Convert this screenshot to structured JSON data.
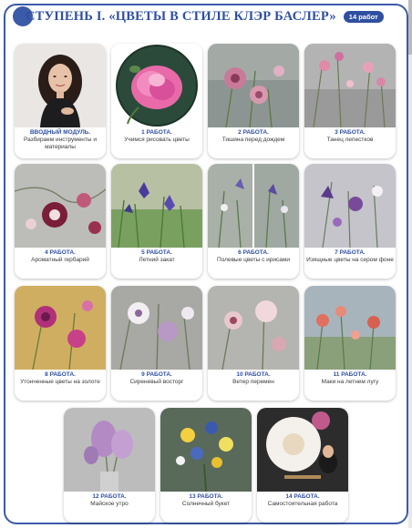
{
  "header": {
    "title": "СТУПЕНЬ I. «ЦВЕТЫ В СТИЛЕ КЛЭР БАСЛЕР»",
    "badge": "14 работ"
  },
  "cards": [
    {
      "num": "ВВОДНЫЙ МОДУЛЬ.",
      "title": "Разбираем инструменты и материалы",
      "image": "portrait-teacher"
    },
    {
      "num": "1 РАБОТА.",
      "title": "Учимся рисовать цветы",
      "image": "pink-peony-round"
    },
    {
      "num": "2 РАБОТА.",
      "title": "Тишина перед дождем",
      "image": "pink-flowers-grey-sky"
    },
    {
      "num": "3 РАБОТА.",
      "title": "Танец лепестков",
      "image": "pink-petals-grey"
    },
    {
      "num": "4 РАБОТА.",
      "title": "Ароматный гербарий",
      "image": "burgundy-flowers-herbarium"
    },
    {
      "num": "5 РАБОТА.",
      "title": "Летний закат",
      "image": "irises-field"
    },
    {
      "num": "6 РАБОТА.",
      "title": "Полевые цветы с ирисами",
      "image": "irises-diptych"
    },
    {
      "num": "7 РАБОТА.",
      "title": "Изящные цветы на сером фоне",
      "image": "purple-flowers-grey"
    },
    {
      "num": "8 РАБОТА.",
      "title": "Утонченные цветы на золоте",
      "image": "magenta-on-gold"
    },
    {
      "num": "9 РАБОТА.",
      "title": "Сиреневый восторг",
      "image": "lilac-white-flowers"
    },
    {
      "num": "10 РАБОТА.",
      "title": "Ветер перемен",
      "image": "pale-pink-flowers"
    },
    {
      "num": "11 РАБОТА.",
      "title": "Маки на летнем лугу",
      "image": "poppies-meadow"
    },
    {
      "num": "12 РАБОТА.",
      "title": "Майское утро",
      "image": "lilac-bouquet"
    },
    {
      "num": "13 РАБОТА.",
      "title": "Солнечный букет",
      "image": "sunny-bouquet"
    },
    {
      "num": "14 РАБОТА.",
      "title": "Самостоятельная работа",
      "image": "artist-large-flower"
    }
  ],
  "colors": {
    "accent": "#2f4fa0",
    "frame": "#3b5aa8"
  }
}
